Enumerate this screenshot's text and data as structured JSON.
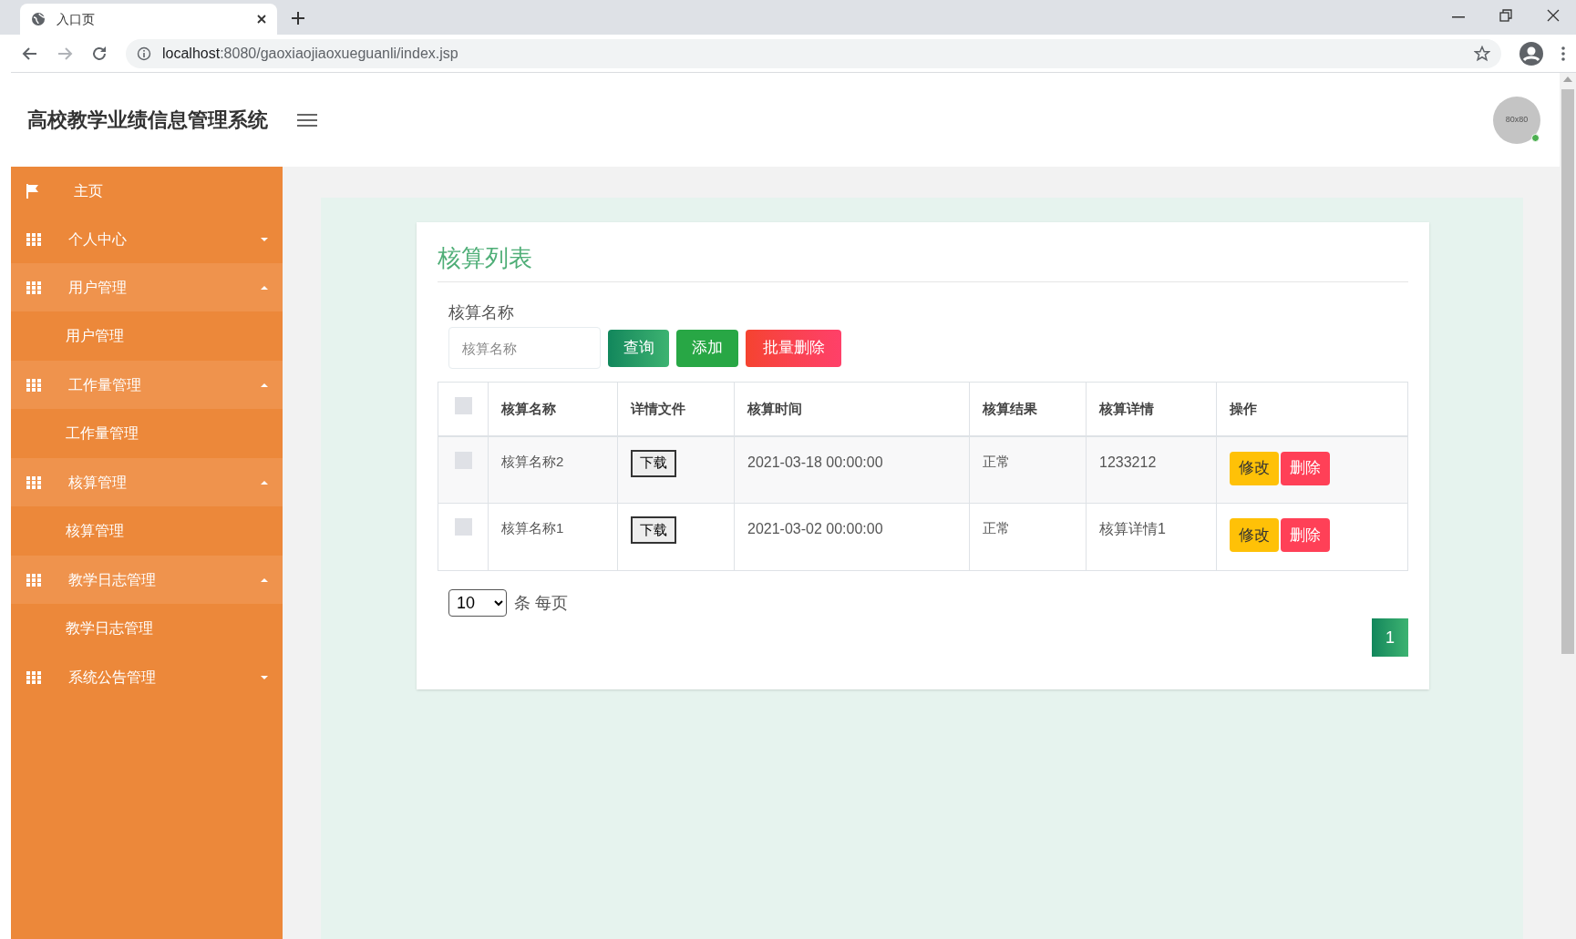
{
  "browser": {
    "tab_title": "入口页",
    "url_host": "localhost",
    "url_rest": ":8080/gaoxiaojiaoxueguanli/index.jsp"
  },
  "header": {
    "title": "高校教学业绩信息管理系统",
    "avatar_text": "80x80",
    "online": true
  },
  "sidebar": {
    "items": [
      {
        "label": "主页",
        "kind": "home"
      },
      {
        "label": "个人中心",
        "kind": "group",
        "expanded": false
      },
      {
        "label": "用户管理",
        "kind": "group",
        "expanded": true,
        "children": [
          {
            "label": "用户管理"
          }
        ]
      },
      {
        "label": "工作量管理",
        "kind": "group",
        "expanded": true,
        "children": [
          {
            "label": "工作量管理"
          }
        ]
      },
      {
        "label": "核算管理",
        "kind": "group",
        "expanded": true,
        "children": [
          {
            "label": "核算管理"
          }
        ]
      },
      {
        "label": "教学日志管理",
        "kind": "group",
        "expanded": true,
        "children": [
          {
            "label": "教学日志管理"
          }
        ]
      },
      {
        "label": "系统公告管理",
        "kind": "group",
        "expanded": false
      }
    ]
  },
  "card": {
    "title": "核算列表",
    "search_label": "核算名称",
    "search_placeholder": "核算名称",
    "buttons": [
      {
        "label": "查询",
        "kind": "query"
      },
      {
        "label": "添加",
        "kind": "add"
      },
      {
        "label": "批量删除",
        "kind": "delete"
      }
    ],
    "table": {
      "header_checked": false,
      "columns": [
        "核算名称",
        "详情文件",
        "核算时间",
        "核算结果",
        "核算详情",
        "操作"
      ],
      "rows": [
        {
          "checked": false,
          "name": "核算名称2",
          "file": "下载",
          "time": "2021-03-18 00:00:00",
          "result": "正常",
          "detail": "1233212",
          "actions": [
            "修改",
            "删除"
          ]
        },
        {
          "checked": false,
          "name": "核算名称1",
          "file": "下载",
          "time": "2021-03-02 00:00:00",
          "result": "正常",
          "detail": "核算详情1",
          "actions": [
            "修改",
            "删除"
          ]
        }
      ]
    },
    "page_size": "10",
    "page_size_suffix": "条 每页",
    "pages": [
      {
        "label": "1",
        "selected": true
      }
    ]
  }
}
